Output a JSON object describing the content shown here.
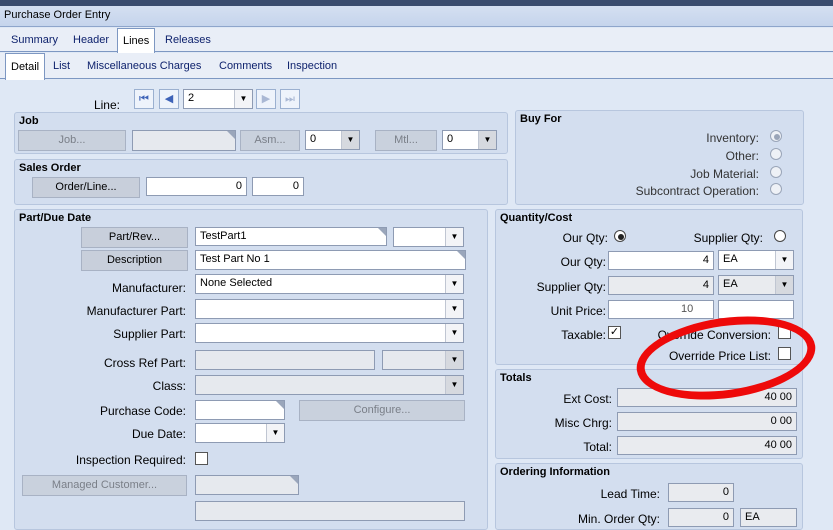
{
  "window": {
    "title": "Purchase Order Entry"
  },
  "tabs_main": [
    "Summary",
    "Header",
    "Lines",
    "Releases"
  ],
  "tabs_sub": [
    "Detail",
    "List",
    "Miscellaneous Charges",
    "Comments",
    "Inspection"
  ],
  "line": {
    "label": "Line:",
    "value": "2"
  },
  "job": {
    "title": "Job",
    "job_btn": "Job...",
    "asm_btn": "Asm...",
    "asm_value": "0",
    "mtl_btn": "Mtl...",
    "mtl_value": "0"
  },
  "sales_order": {
    "title": "Sales Order",
    "btn": "Order/Line...",
    "order": "0",
    "line": "0"
  },
  "buy_for": {
    "title": "Buy For",
    "options": [
      "Inventory:",
      "Other:",
      "Job Material:",
      "Subcontract Operation:"
    ]
  },
  "part": {
    "title": "Part/Due Date",
    "part_rev_btn": "Part/Rev...",
    "part_value": "TestPart1",
    "desc_btn": "Description",
    "desc_value": "Test Part No 1",
    "manufacturer_label": "Manufacturer:",
    "manufacturer_value": "None Selected",
    "mfr_part_label": "Manufacturer Part:",
    "supplier_part_label": "Supplier Part:",
    "cross_ref_label": "Cross Ref Part:",
    "class_label": "Class:",
    "purchase_code_label": "Purchase Code:",
    "configure_btn": "Configure...",
    "due_date_label": "Due Date:",
    "inspection_label": "Inspection Required:",
    "managed_btn": "Managed Customer..."
  },
  "qty": {
    "title": "Quantity/Cost",
    "our_qty_radio": "Our Qty:",
    "supplier_qty_radio": "Supplier Qty:",
    "our_qty_label": "Our Qty:",
    "our_qty": "4",
    "our_uom": "EA",
    "supplier_qty_label": "Supplier Qty:",
    "supplier_qty": "4",
    "supplier_uom": "EA",
    "unit_price_label": "Unit Price:",
    "unit_price_partial": "10",
    "taxable_label": "Taxable:",
    "taxable_mark": "✓",
    "override_conv_label": "Override Conversion:",
    "override_price_label": "Override Price List:"
  },
  "totals": {
    "title": "Totals",
    "ext_cost_label": "Ext Cost:",
    "ext_cost": "40 00",
    "misc_label": "Misc Chrg:",
    "misc": "0 00",
    "total_label": "Total:",
    "total": "40 00"
  },
  "ordering": {
    "title": "Ordering Information",
    "lead_label": "Lead Time:",
    "lead": "0",
    "min_label": "Min. Order Qty:",
    "min": "0",
    "min_uom": "EA"
  },
  "colors": {
    "annotation": "#ee0a0a",
    "tab_text": "#0b1f6b"
  },
  "icons": {
    "nav_first": "⏮",
    "nav_prev": "◀",
    "nav_next": "▶",
    "nav_last": "⏭",
    "dropdown": "▼"
  }
}
